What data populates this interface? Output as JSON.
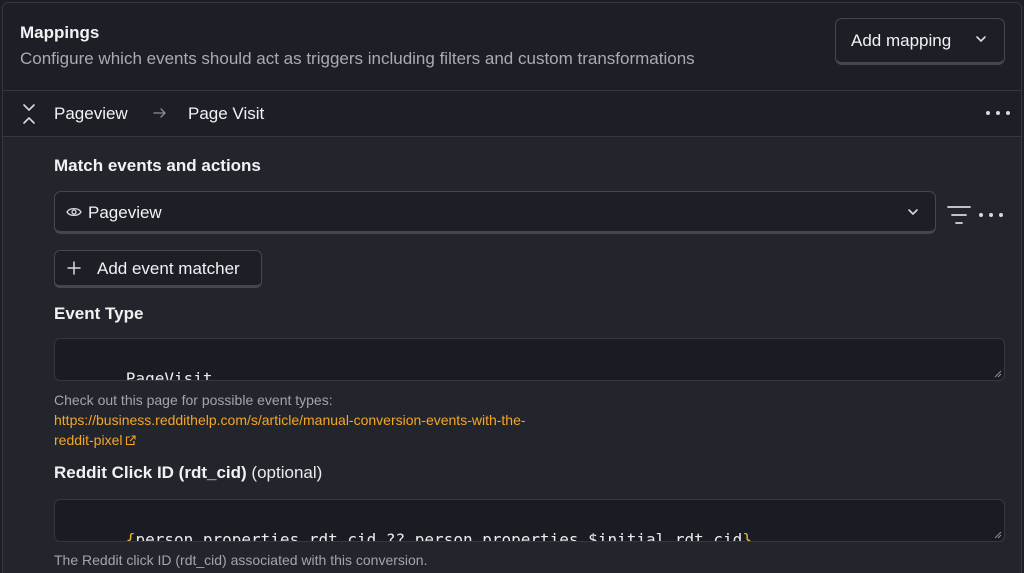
{
  "header": {
    "title": "Mappings",
    "subtitle": "Configure which events should act as triggers including filters and custom transformations",
    "add_mapping_label": "Add mapping"
  },
  "mapping": {
    "from": "Pageview",
    "to": "Page Visit"
  },
  "match": {
    "label": "Match events and actions",
    "selected_event": "Pageview",
    "add_matcher_label": "Add event matcher"
  },
  "event_type": {
    "label": "Event Type",
    "value": "PageVisit",
    "help": "Check out this page for possible event types:",
    "link_line1": "https://business.reddithelp.com/s/article/manual-conversion-events-with-the-",
    "link_line2": "reddit-pixel"
  },
  "rdt_cid": {
    "label": "Reddit Click ID (rdt_cid)",
    "optional": "(optional)",
    "brace_open": "{",
    "value": "person.properties.rdt_cid ?? person.properties.$initial_rdt_cid",
    "brace_close": "}",
    "help": "The Reddit click ID (rdt_cid) associated with this conversion."
  },
  "colors": {
    "accent_link": "#f6a623",
    "brace": "#f2b233",
    "background": "#1d1f27",
    "body_background": "#23252d"
  },
  "icons": [
    "chevron-down-icon",
    "collapse-icon",
    "arrow-right-icon",
    "more-horizontal-icon",
    "eye-icon",
    "filter-icon",
    "plus-icon",
    "external-link-icon",
    "resize-grip-icon"
  ]
}
